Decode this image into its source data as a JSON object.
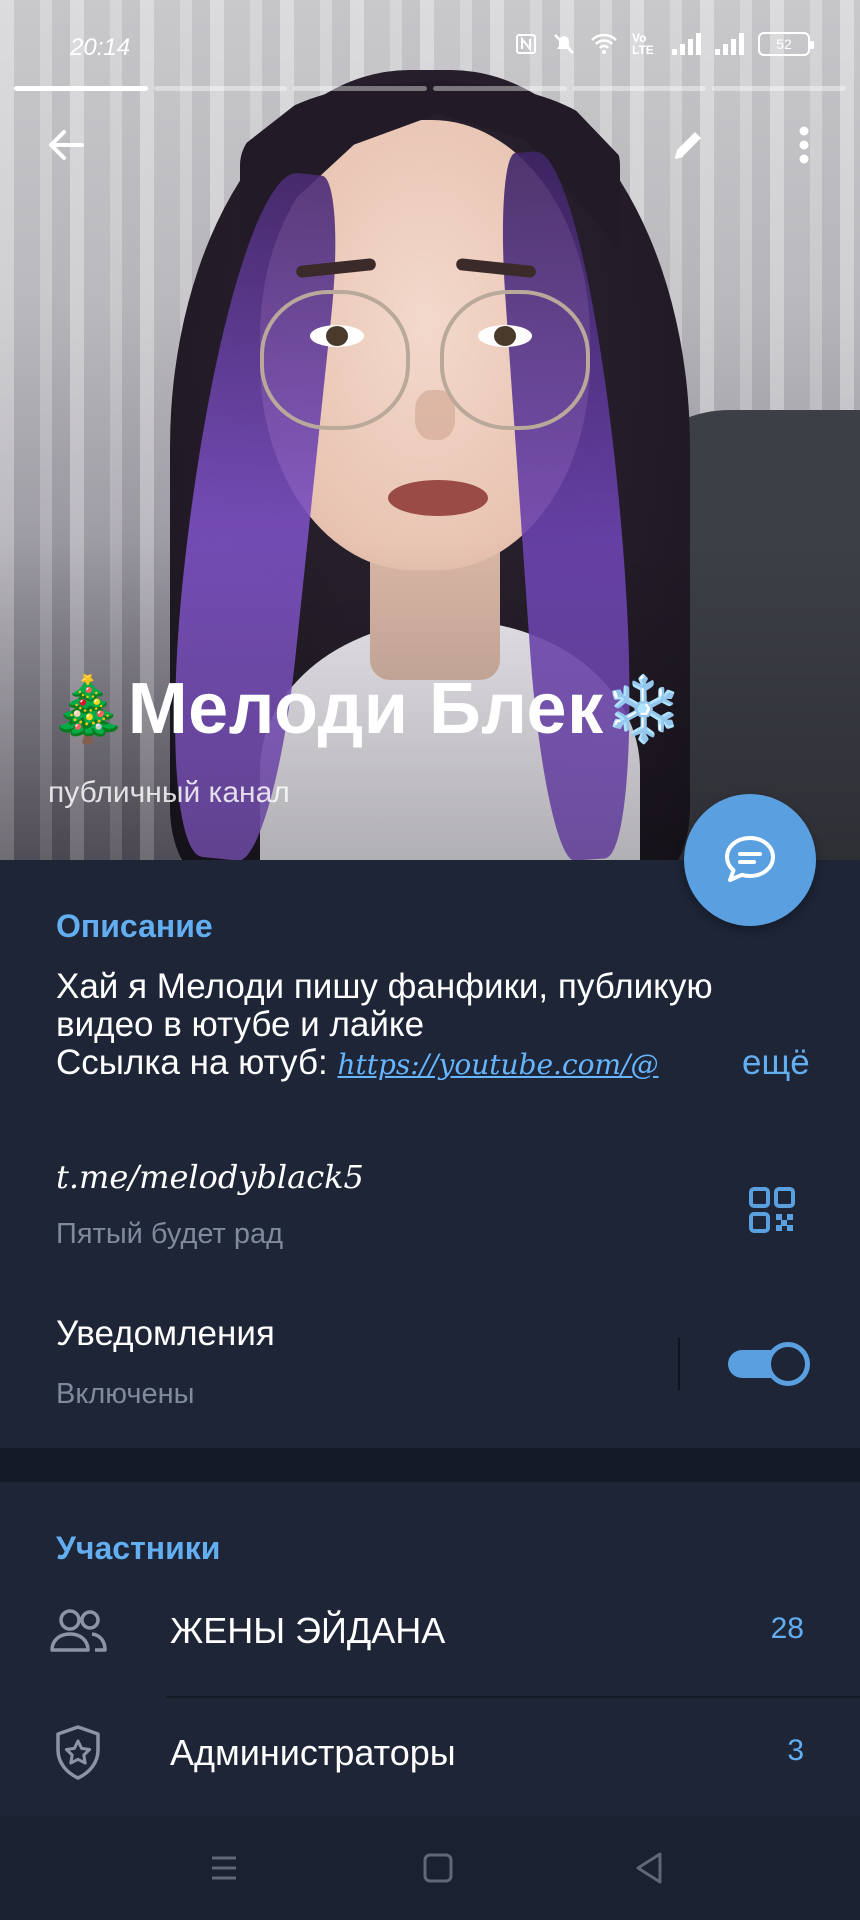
{
  "status_bar": {
    "time": "20:14",
    "battery": "52",
    "icons": [
      "nfc-icon",
      "mute-icon",
      "wifi-icon",
      "volte-icon",
      "signal-icon",
      "signal-icon",
      "battery-icon"
    ],
    "volte": "Vo LTE"
  },
  "story_progress": {
    "segments": 6,
    "active_fraction": 0.65
  },
  "profile": {
    "name": "Мелоди Блек",
    "emoji_left": "🎄",
    "emoji_right": "❄️",
    "subtitle": "публичный канал"
  },
  "description": {
    "title": "Описание",
    "line1": "Хай я Мелоди пишу фанфики, публикую",
    "line2": "видео в ютубе и лайке",
    "line3_prefix": "Ссылка на ютуб: ",
    "link": "https://youtube.com/@",
    "more": "ещё"
  },
  "link_row": {
    "handle": "t.me/melodyblack5",
    "caption": "Пятый будет рад"
  },
  "notifications": {
    "title": "Уведомления",
    "status": "Включены",
    "enabled": true
  },
  "members": {
    "title": "Участники",
    "items": [
      {
        "label": "ЖЕНЫ ЭЙДАНА",
        "count": "28",
        "icon": "users-icon"
      },
      {
        "label": "Администраторы",
        "count": "3",
        "icon": "admin-shield-icon"
      }
    ]
  },
  "colors": {
    "accent": "#5aa0e0",
    "link": "#63aef0",
    "panel_bg": "#1d2537",
    "page_bg": "#141a26",
    "muted_text": "#7f8a9d"
  }
}
